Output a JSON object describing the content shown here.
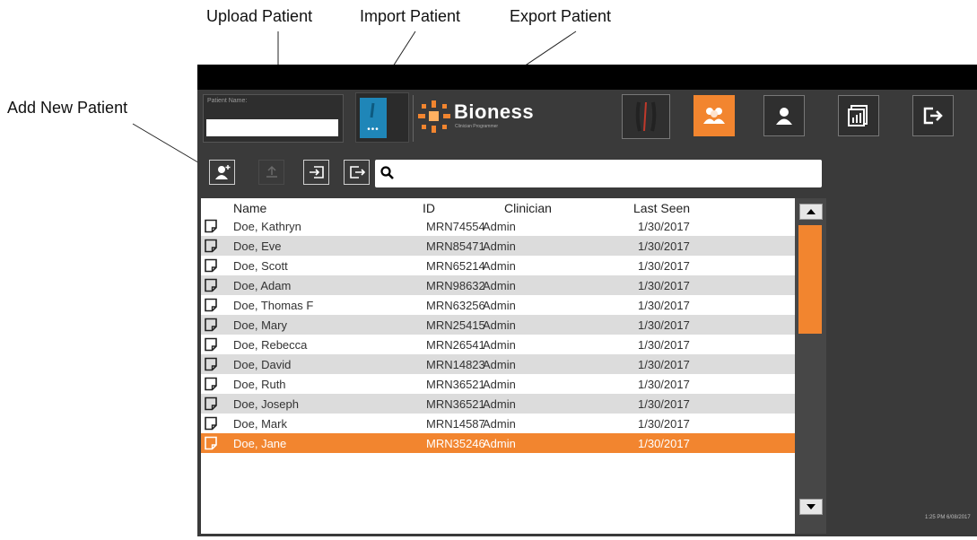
{
  "callouts": {
    "upload": "Upload Patient",
    "import": "Import Patient",
    "export": "Export Patient",
    "add": "Add New Patient"
  },
  "header": {
    "patient_label": "Patient Name:",
    "patient_value": "",
    "device_dots": "•••",
    "brand": "Bioness",
    "brand_sub": "Clinician Programmer",
    "nav_icons": [
      "bioness-device-icon",
      "patients-icon",
      "user-icon",
      "reports-icon",
      "logout-icon"
    ],
    "active_nav": "patients-icon"
  },
  "toolbar": {
    "buttons": [
      "add-new-patient-button",
      "upload-patient-button",
      "import-patient-button",
      "export-patient-button"
    ],
    "upload_disabled": true,
    "search_placeholder": ""
  },
  "list": {
    "columns": [
      "Name",
      "ID",
      "Clinician",
      "Last Seen"
    ],
    "rows": [
      {
        "name": "Doe, Kathryn",
        "id": "MRN74554",
        "clinician": "Admin",
        "last_seen": "1/30/2017"
      },
      {
        "name": "Doe, Eve",
        "id": "MRN85471",
        "clinician": "Admin",
        "last_seen": "1/30/2017"
      },
      {
        "name": "Doe, Scott",
        "id": "MRN65214",
        "clinician": "Admin",
        "last_seen": "1/30/2017"
      },
      {
        "name": "Doe, Adam",
        "id": "MRN98632",
        "clinician": "Admin",
        "last_seen": "1/30/2017"
      },
      {
        "name": "Doe, Thomas F",
        "id": "MRN63256",
        "clinician": "Admin",
        "last_seen": "1/30/2017"
      },
      {
        "name": "Doe, Mary",
        "id": "MRN25415",
        "clinician": "Admin",
        "last_seen": "1/30/2017"
      },
      {
        "name": "Doe, Rebecca",
        "id": "MRN26541",
        "clinician": "Admin",
        "last_seen": "1/30/2017"
      },
      {
        "name": "Doe, David",
        "id": "MRN14823",
        "clinician": "Admin",
        "last_seen": "1/30/2017"
      },
      {
        "name": "Doe, Ruth",
        "id": "MRN36521",
        "clinician": "Admin",
        "last_seen": "1/30/2017"
      },
      {
        "name": "Doe, Joseph",
        "id": "MRN36521",
        "clinician": "Admin",
        "last_seen": "1/30/2017"
      },
      {
        "name": "Doe, Mark",
        "id": "MRN14587",
        "clinician": "Admin",
        "last_seen": "1/30/2017"
      },
      {
        "name": "Doe, Jane",
        "id": "MRN35246",
        "clinician": "Admin",
        "last_seen": "1/30/2017"
      }
    ],
    "selected_index": 11
  },
  "status": {
    "timestamp": "1:25 PM 6/08/2017"
  },
  "colors": {
    "accent": "#f2852f",
    "device_blue": "#1f86b8",
    "panel_bg": "#3a3a3a",
    "row_alt": "#dcdcdc"
  }
}
